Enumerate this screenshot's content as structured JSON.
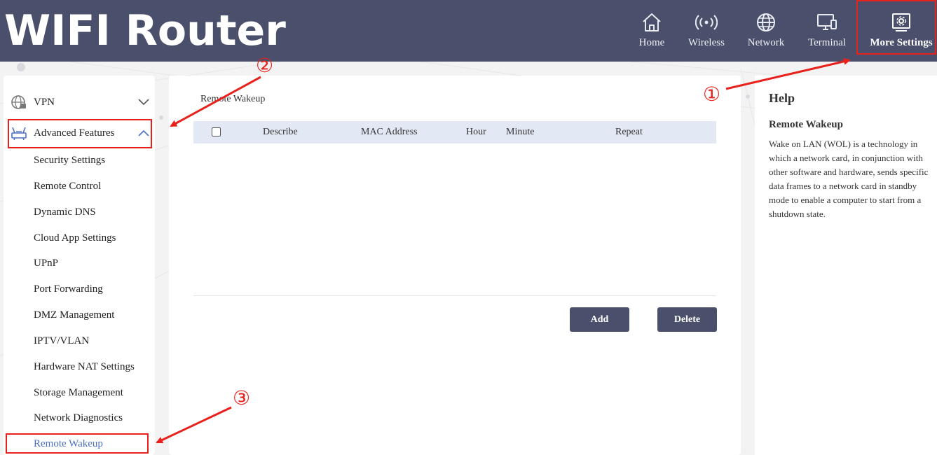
{
  "header": {
    "brand": "WIFI Router",
    "nav": [
      {
        "label": "Home",
        "icon": "home-icon"
      },
      {
        "label": "Wireless",
        "icon": "wireless-icon"
      },
      {
        "label": "Network",
        "icon": "globe-icon"
      },
      {
        "label": "Terminal",
        "icon": "terminal-icon"
      },
      {
        "label": "More Settings",
        "icon": "settings-icon",
        "active": true
      }
    ]
  },
  "sidebar": {
    "sections": [
      {
        "label": "VPN",
        "icon": "vpn-icon",
        "expanded": false
      },
      {
        "label": "Advanced Features",
        "icon": "router-icon",
        "expanded": true
      }
    ],
    "items": [
      "Security Settings",
      "Remote Control",
      "Dynamic DNS",
      "Cloud App Settings",
      "UPnP",
      "Port Forwarding",
      "DMZ Management",
      "IPTV/VLAN",
      "Hardware NAT Settings",
      "Storage Management",
      "Network Diagnostics",
      "Remote Wakeup"
    ],
    "active_item": "Remote Wakeup"
  },
  "main": {
    "title": "Remote Wakeup",
    "table": {
      "columns": [
        "Describe",
        "MAC Address",
        "Hour",
        "Minute",
        "Repeat"
      ],
      "rows": []
    },
    "add_label": "Add",
    "delete_label": "Delete"
  },
  "help": {
    "title": "Help",
    "subtitle": "Remote Wakeup",
    "text": "Wake on LAN (WOL) is a technology in which a network card, in conjunction with other software and hardware, sends specific data frames to a network card in standby mode to enable a computer to start from a shutdown state."
  },
  "annotations": [
    "①",
    "②",
    "③"
  ],
  "colors": {
    "header_bg": "#4a506b",
    "accent": "#4a6fc4",
    "annotation_red": "#e8211c",
    "table_head": "#e3e9f4"
  }
}
